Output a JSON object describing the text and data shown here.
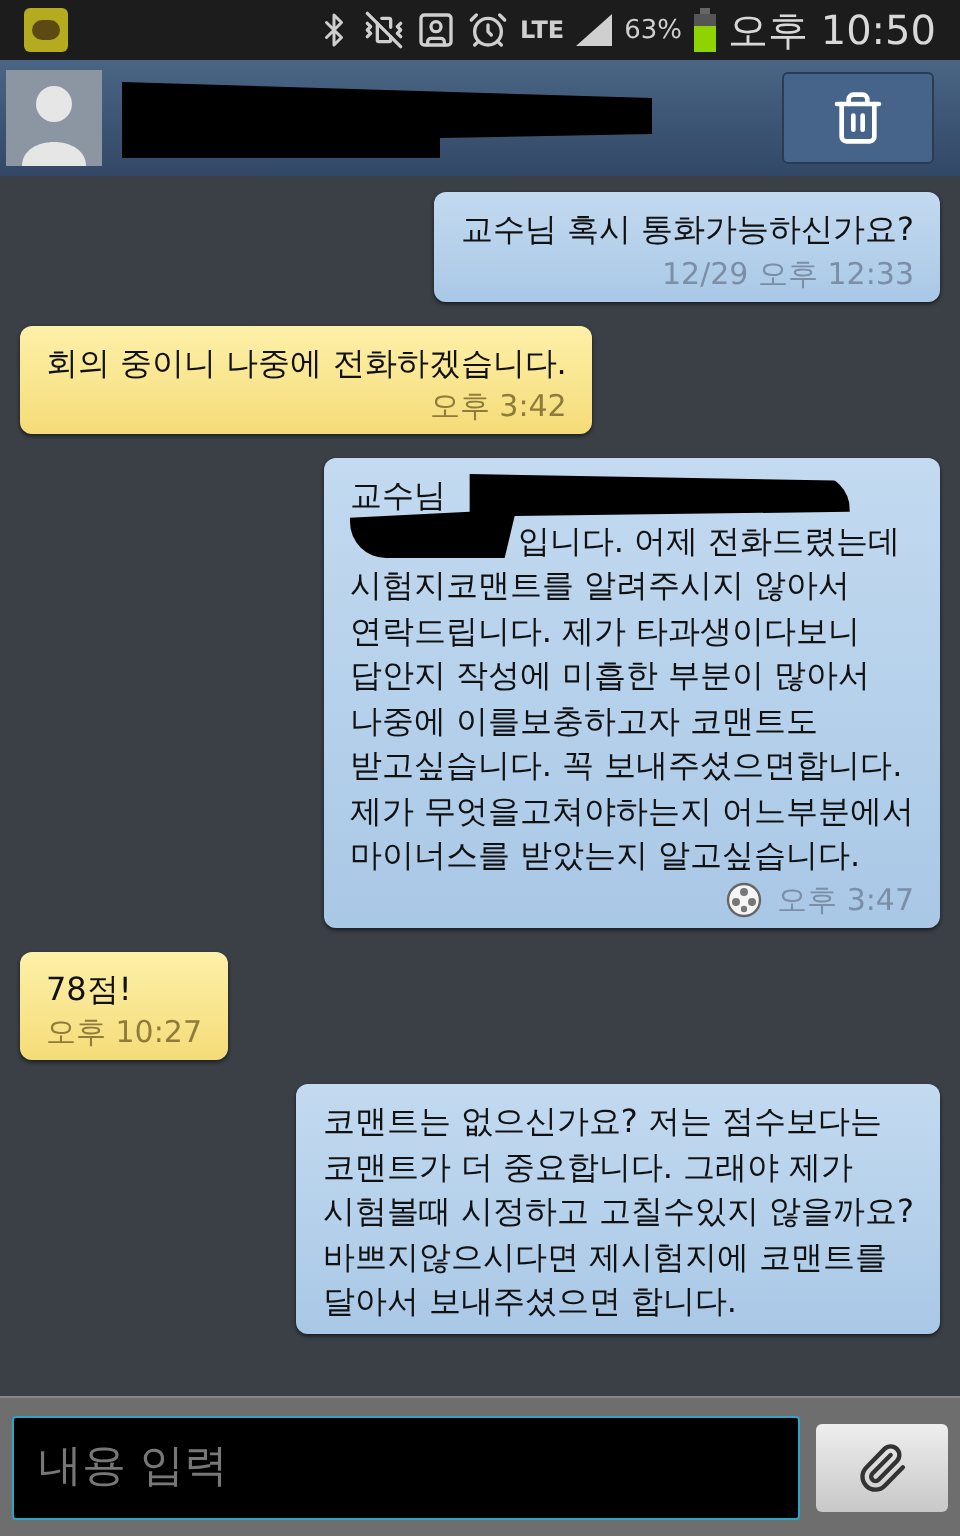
{
  "status_bar": {
    "network": "LTE",
    "battery": "63%",
    "time": "오후 10:50"
  },
  "messages": [
    {
      "kind": "sent",
      "lines": [
        "교수님 혹시 통화가능하신가요?"
      ],
      "time": "12/29 오후 12:33"
    },
    {
      "kind": "received",
      "lines": [
        "회의 중이니 나중에 전화하겠습니다."
      ],
      "time": "오후 3:42"
    },
    {
      "kind": "sent",
      "lines": [
        "교수님",
        "입니다. 어제 전화드렸는데",
        "시험지코맨트를 알려주시지 않아서",
        "연락드립니다. 제가 타과생이다보니",
        "답안지 작성에 미흡한 부분이 많아서",
        "나중에 이를보충하고자 코맨트도",
        "받고싶습니다. 꼭 보내주셨으면합니다.",
        "제가 무엇을고쳐야하는지 어느부분에서",
        "마이너스를 받았는지 알고싶습니다."
      ],
      "time": "오후 3:47",
      "redacted": true,
      "attachment": true
    },
    {
      "kind": "received",
      "lines": [
        "78점!"
      ],
      "time": "오후 10:27"
    },
    {
      "kind": "sent",
      "lines": [
        "코맨트는 없으신가요? 저는 점수보다는",
        "코맨트가 더 중요합니다. 그래야 제가",
        "시험볼때 시정하고 고칠수있지 않을까요?",
        "바쁘지않으시다면 제시험지에 코맨트를",
        "달아서 보내주셨으면 합니다."
      ]
    }
  ],
  "composer": {
    "placeholder": "내용 입력"
  }
}
